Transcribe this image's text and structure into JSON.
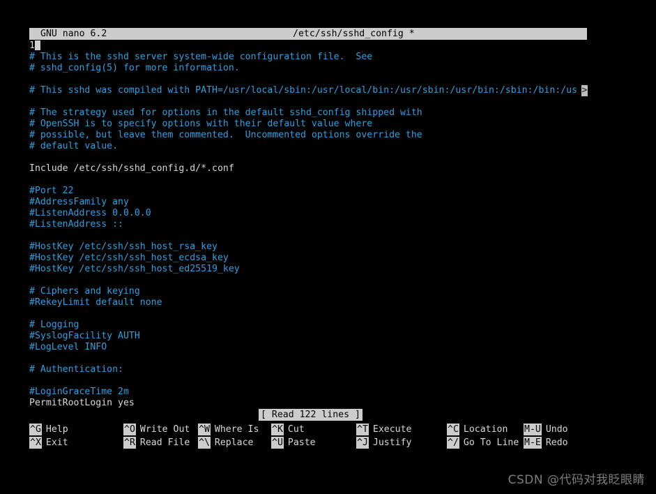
{
  "app": {
    "name": "GNU nano",
    "version_label": "GNU nano 6.2",
    "filename": "/etc/ssh/sshd_config *",
    "modified_flag": "*"
  },
  "colors": {
    "background": "#000000",
    "comment_text": "#2e9fe0",
    "code_text": "#d8d8d8",
    "bar_background": "#cccccc",
    "bar_text": "#000000",
    "watermark_text": "#7d7d7d"
  },
  "buffer": {
    "cursor_line_prefix": "1",
    "continuation_marker": ">",
    "lines": [
      {
        "text": "1",
        "kind": "code",
        "cursor": true
      },
      {
        "text": "# This is the sshd server system-wide configuration file.  See",
        "kind": "comment"
      },
      {
        "text": "# sshd_config(5) for more information.",
        "kind": "comment"
      },
      {
        "text": "",
        "kind": "blank"
      },
      {
        "text": "# This sshd was compiled with PATH=/usr/local/sbin:/usr/local/bin:/usr/sbin:/usr/bin:/sbin:/bin:/us",
        "kind": "comment",
        "truncated": true
      },
      {
        "text": "",
        "kind": "blank"
      },
      {
        "text": "# The strategy used for options in the default sshd_config shipped with",
        "kind": "comment"
      },
      {
        "text": "# OpenSSH is to specify options with their default value where",
        "kind": "comment"
      },
      {
        "text": "# possible, but leave them commented.  Uncommented options override the",
        "kind": "comment"
      },
      {
        "text": "# default value.",
        "kind": "comment"
      },
      {
        "text": "",
        "kind": "blank"
      },
      {
        "text": "Include /etc/ssh/sshd_config.d/*.conf",
        "kind": "code"
      },
      {
        "text": "",
        "kind": "blank"
      },
      {
        "text": "#Port 22",
        "kind": "comment"
      },
      {
        "text": "#AddressFamily any",
        "kind": "comment"
      },
      {
        "text": "#ListenAddress 0.0.0.0",
        "kind": "comment"
      },
      {
        "text": "#ListenAddress ::",
        "kind": "comment"
      },
      {
        "text": "",
        "kind": "blank"
      },
      {
        "text": "#HostKey /etc/ssh/ssh_host_rsa_key",
        "kind": "comment"
      },
      {
        "text": "#HostKey /etc/ssh/ssh_host_ecdsa_key",
        "kind": "comment"
      },
      {
        "text": "#HostKey /etc/ssh/ssh_host_ed25519_key",
        "kind": "comment"
      },
      {
        "text": "",
        "kind": "blank"
      },
      {
        "text": "# Ciphers and keying",
        "kind": "comment"
      },
      {
        "text": "#RekeyLimit default none",
        "kind": "comment"
      },
      {
        "text": "",
        "kind": "blank"
      },
      {
        "text": "# Logging",
        "kind": "comment"
      },
      {
        "text": "#SyslogFacility AUTH",
        "kind": "comment"
      },
      {
        "text": "#LogLevel INFO",
        "kind": "comment"
      },
      {
        "text": "",
        "kind": "blank"
      },
      {
        "text": "# Authentication:",
        "kind": "comment"
      },
      {
        "text": "",
        "kind": "blank"
      },
      {
        "text": "#LoginGraceTime 2m",
        "kind": "comment"
      },
      {
        "text": "PermitRootLogin yes",
        "kind": "code"
      }
    ]
  },
  "status": {
    "message": "[ Read 122 lines ]"
  },
  "shortcuts": {
    "row1": [
      {
        "key": "^G",
        "label": "Help"
      },
      {
        "key": "^O",
        "label": "Write Out"
      },
      {
        "key": "^W",
        "label": "Where Is"
      },
      {
        "key": "^K",
        "label": "Cut"
      },
      {
        "key": "^T",
        "label": "Execute"
      },
      {
        "key": "^C",
        "label": "Location"
      },
      {
        "key": "M-U",
        "label": "Undo"
      }
    ],
    "row2": [
      {
        "key": "^X",
        "label": "Exit"
      },
      {
        "key": "^R",
        "label": "Read File"
      },
      {
        "key": "^\\",
        "label": "Replace"
      },
      {
        "key": "^U",
        "label": "Paste"
      },
      {
        "key": "^J",
        "label": "Justify"
      },
      {
        "key": "^/",
        "label": "Go To Line"
      },
      {
        "key": "M-E",
        "label": "Redo"
      }
    ]
  },
  "watermark": {
    "text": "CSDN @代码对我眨眼睛"
  }
}
